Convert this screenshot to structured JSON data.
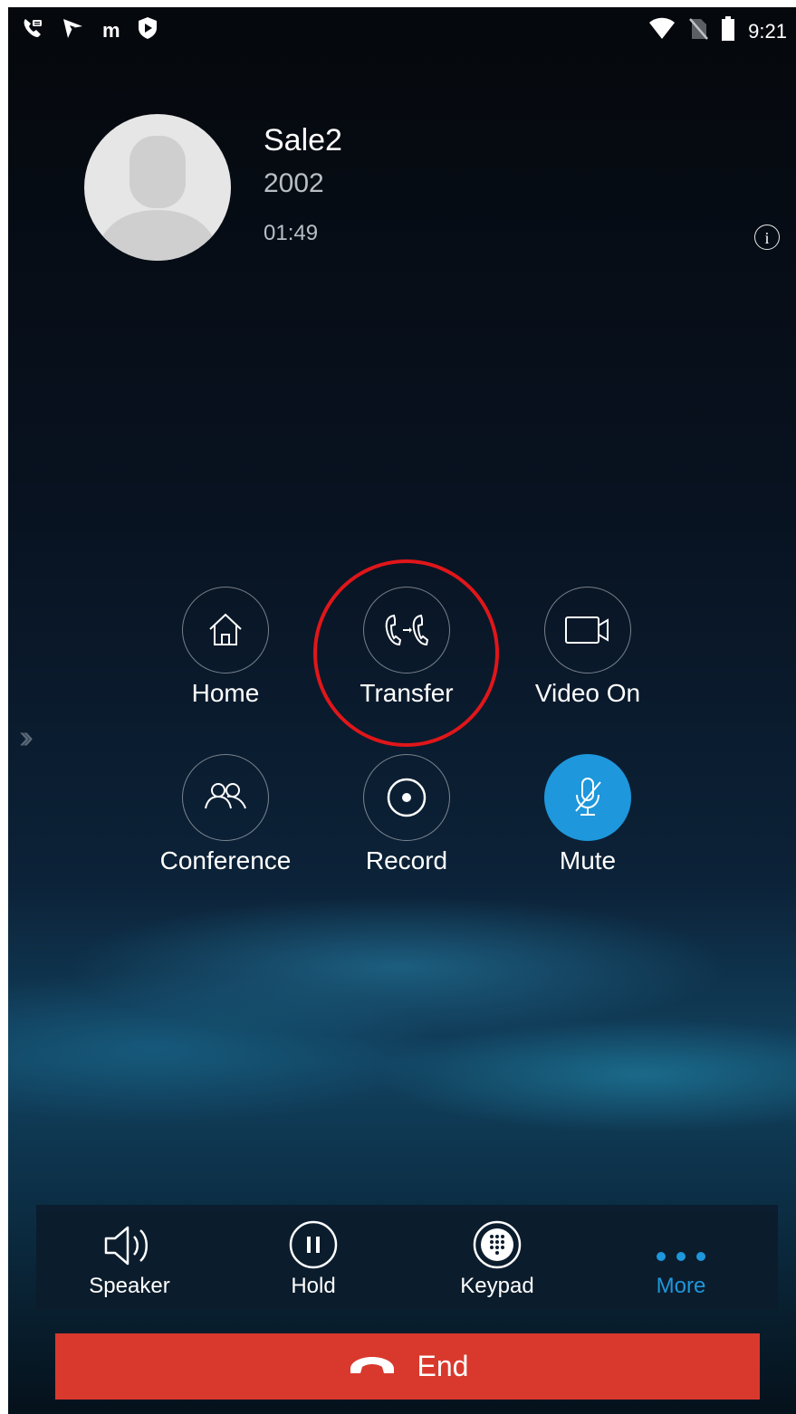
{
  "status_bar": {
    "icons": [
      "phone-app-icon",
      "app-icon",
      "m-icon",
      "shield-icon"
    ],
    "m_label": "m",
    "right_icons": [
      "wifi-icon",
      "no-sim-icon",
      "battery-icon"
    ],
    "time": "9:21"
  },
  "contact": {
    "name": "Sale2",
    "number": "2002",
    "duration": "01:49",
    "info_label": "i"
  },
  "actions": [
    {
      "label": "Home",
      "icon": "home-icon",
      "active": false
    },
    {
      "label": "Transfer",
      "icon": "transfer-icon",
      "active": false,
      "highlighted": true
    },
    {
      "label": "Video On",
      "icon": "video-camera-icon",
      "active": false
    },
    {
      "label": "Conference",
      "icon": "conference-icon",
      "active": false
    },
    {
      "label": "Record",
      "icon": "record-icon",
      "active": false
    },
    {
      "label": "Mute",
      "icon": "mic-muted-icon",
      "active": true
    }
  ],
  "toolbar": {
    "items": [
      {
        "label": "Speaker",
        "icon": "speaker-icon"
      },
      {
        "label": "Hold",
        "icon": "pause-icon"
      },
      {
        "label": "Keypad",
        "icon": "keypad-icon"
      },
      {
        "label": "More",
        "icon": "more-dots-icon",
        "selected": true
      }
    ]
  },
  "end_call": {
    "label": "End",
    "icon": "hangup-icon"
  },
  "colors": {
    "accent": "#1e97dc",
    "end_button": "#d9392d",
    "highlight_ring": "#e0161a"
  }
}
